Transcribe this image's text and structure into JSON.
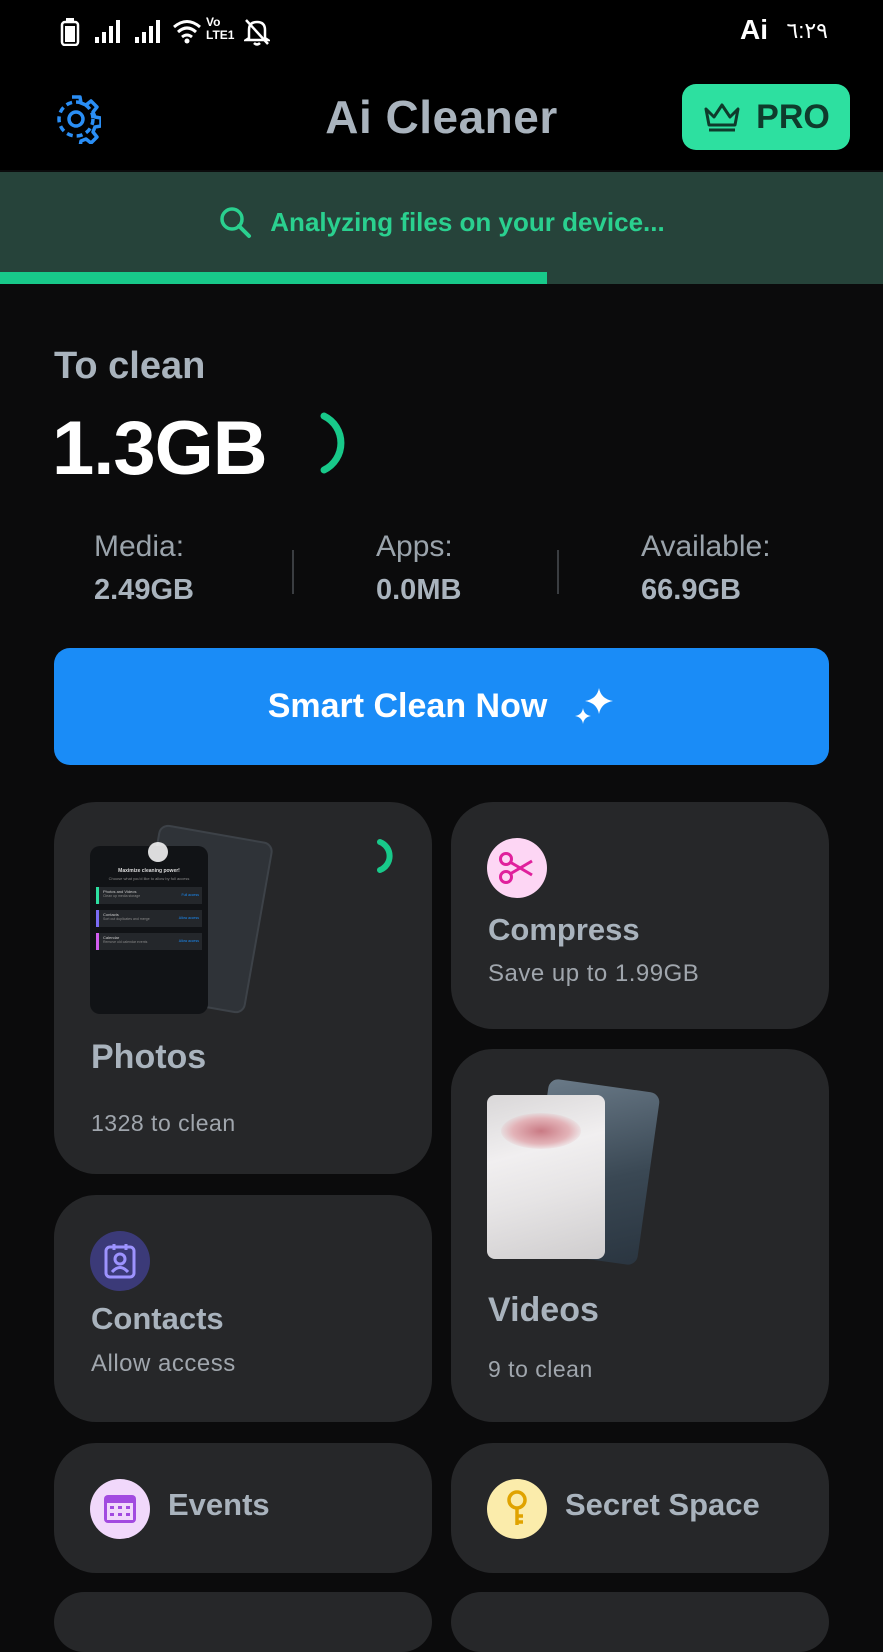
{
  "status_bar": {
    "left_icons": [
      "battery-icon",
      "signal-icon",
      "signal-icon",
      "wifi-icon",
      "volte-icon",
      "notifications-off-icon"
    ],
    "ai_badge": "Ai",
    "time": "٦:٢٩"
  },
  "header": {
    "title": "Ai Cleaner",
    "pro_label": "PRO",
    "settings_icon": "gear-icon",
    "pro_icon": "crown-icon"
  },
  "analyzing": {
    "text": "Analyzing files on your device...",
    "icon": "search-icon",
    "progress": 0.62
  },
  "summary": {
    "to_clean_label": "To clean",
    "to_clean_value": "1.3GB",
    "stats": [
      {
        "label": "Media:",
        "value": "2.49GB"
      },
      {
        "label": "Apps:",
        "value": "0.0MB"
      },
      {
        "label": "Available:",
        "value": "66.9GB"
      }
    ]
  },
  "smart_clean": {
    "label": "Smart Clean Now",
    "icon": "sparkle-icon"
  },
  "cards": {
    "photos": {
      "title": "Photos",
      "subtitle": "1328 to clean",
      "preview": {
        "heading": "Maximize cleaning power!",
        "sub": "Choose what you'd like to allow by full access",
        "rows": [
          {
            "title": "Photos and Videos",
            "sub": "Clean up media storage",
            "action": "Full access"
          },
          {
            "title": "Contacts",
            "sub": "Sort out duplicates and merge",
            "action": "Allow access"
          },
          {
            "title": "Calendar",
            "sub": "Remove old calendar events",
            "action": "Allow access"
          }
        ]
      }
    },
    "compress": {
      "title": "Compress",
      "subtitle": "Save up to 1.99GB",
      "icon": "scissors-icon"
    },
    "videos": {
      "title": "Videos",
      "subtitle": "9 to clean"
    },
    "contacts": {
      "title": "Contacts",
      "subtitle": "Allow access",
      "icon": "contact-card-icon"
    },
    "events": {
      "title": "Events",
      "icon": "calendar-icon"
    },
    "secret": {
      "title": "Secret Space",
      "icon": "key-icon"
    }
  },
  "colors": {
    "accent_green": "#2de0a0",
    "button_blue": "#1a8cf7",
    "card_bg": "#262729",
    "analyze_bg": "#26433a"
  }
}
